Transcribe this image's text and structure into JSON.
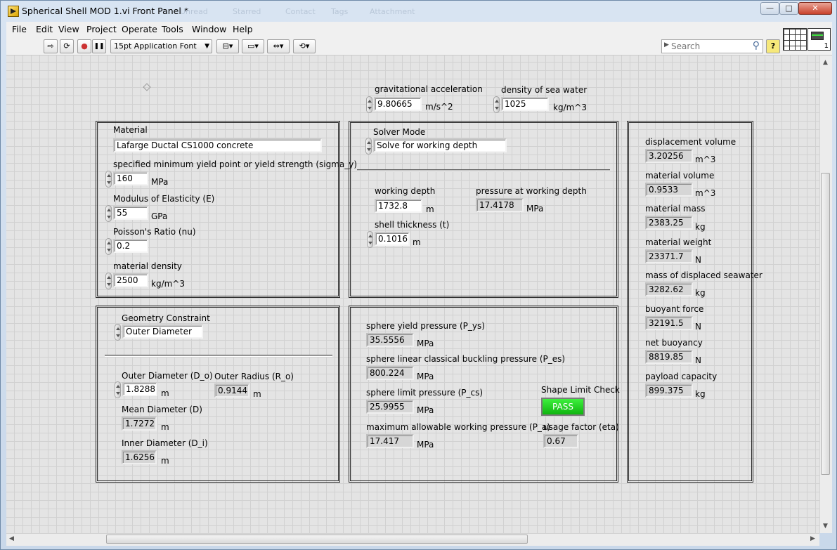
{
  "window": {
    "title": "Spherical Shell MOD 1.vi Front Panel *",
    "ghost_title_items": [
      "Unread",
      "Starred",
      "Contact",
      "Tags",
      "Attachment"
    ],
    "controls": {
      "minimize": "—",
      "maximize": "□",
      "close": "✕"
    }
  },
  "menu": [
    "File",
    "Edit",
    "View",
    "Project",
    "Operate",
    "Tools",
    "Window",
    "Help"
  ],
  "toolbar": {
    "run": "⇨",
    "run_continuous": "⟳",
    "abort": "●",
    "pause": "❚❚",
    "font_select": "15pt Application Font",
    "align": "⊟▾",
    "distribute": "▭▾",
    "resize": "⇔▾",
    "reorder": "⟲▾",
    "search_placeholder": "Search",
    "help": "?",
    "vi_icon_label": "1"
  },
  "globals": {
    "gravity": {
      "label": "gravitational acceleration",
      "value": "9.80665",
      "unit": "m/s^2"
    },
    "sea_density": {
      "label": "density of sea water",
      "value": "1025",
      "unit": "kg/m^3"
    }
  },
  "material_box": {
    "material_label": "Material",
    "material_value": "Lafarge Ductal CS1000 concrete",
    "yield": {
      "label": "specified minimum yield point or yield strength (sigma_y)",
      "value": "160",
      "unit": "MPa"
    },
    "modulus": {
      "label": "Modulus of Elasticity (E)",
      "value": "55",
      "unit": "GPa"
    },
    "poisson": {
      "label": "Poisson's Ratio (nu)",
      "value": "0.2"
    },
    "density": {
      "label": "material density",
      "value": "2500",
      "unit": "kg/m^3"
    }
  },
  "solver_box": {
    "mode_label": "Solver Mode",
    "mode_value": "Solve for working depth",
    "depth": {
      "label": "working depth",
      "value": "1732.8",
      "unit": "m"
    },
    "pressure": {
      "label": "pressure at working depth",
      "value": "17.4178",
      "unit": "MPa"
    },
    "thickness": {
      "label": "shell thickness (t)",
      "value": "0.1016",
      "unit": "m"
    }
  },
  "geometry_box": {
    "constraint_label": "Geometry Constraint",
    "constraint_value": "Outer Diameter",
    "outer_d": {
      "label": "Outer Diameter (D_o)",
      "value": "1.8288",
      "unit": "m"
    },
    "outer_r": {
      "label": "Outer Radius (R_o)",
      "value": "0.9144",
      "unit": "m"
    },
    "mean_d": {
      "label": "Mean Diameter (D)",
      "value": "1.7272",
      "unit": "m"
    },
    "inner_d": {
      "label": "Inner Diameter (D_i)",
      "value": "1.6256",
      "unit": "m"
    }
  },
  "pressure_box": {
    "yield_p": {
      "label": "sphere yield pressure (P_ys)",
      "value": "35.5556",
      "unit": "MPa"
    },
    "buckling_p": {
      "label": "sphere linear classical buckling pressure (P_es)",
      "value": "800.224",
      "unit": "MPa"
    },
    "limit_p": {
      "label": "sphere limit pressure (P_cs)",
      "value": "25.9955",
      "unit": "MPa"
    },
    "allow_p": {
      "label": "maximum allowable working pressure (P_a)",
      "value": "17.417",
      "unit": "MPa"
    },
    "shape_check": {
      "label": "Shape Limit Check",
      "value": "PASS",
      "color": "#22d822"
    },
    "usage": {
      "label": "usage factor (eta)",
      "value": "0.67"
    }
  },
  "results_box": [
    {
      "label": "displacement volume",
      "value": "3.20256",
      "unit": "m^3"
    },
    {
      "label": "material volume",
      "value": "0.9533",
      "unit": "m^3"
    },
    {
      "label": "material mass",
      "value": "2383.25",
      "unit": "kg"
    },
    {
      "label": "material weight",
      "value": "23371.7",
      "unit": "N"
    },
    {
      "label": "mass of displaced seawater",
      "value": "3282.62",
      "unit": "kg"
    },
    {
      "label": "buoyant force",
      "value": "32191.5",
      "unit": "N"
    },
    {
      "label": "net buoyancy",
      "value": "8819.85",
      "unit": "N"
    },
    {
      "label": "payload capacity",
      "value": "899.375",
      "unit": "kg"
    }
  ]
}
